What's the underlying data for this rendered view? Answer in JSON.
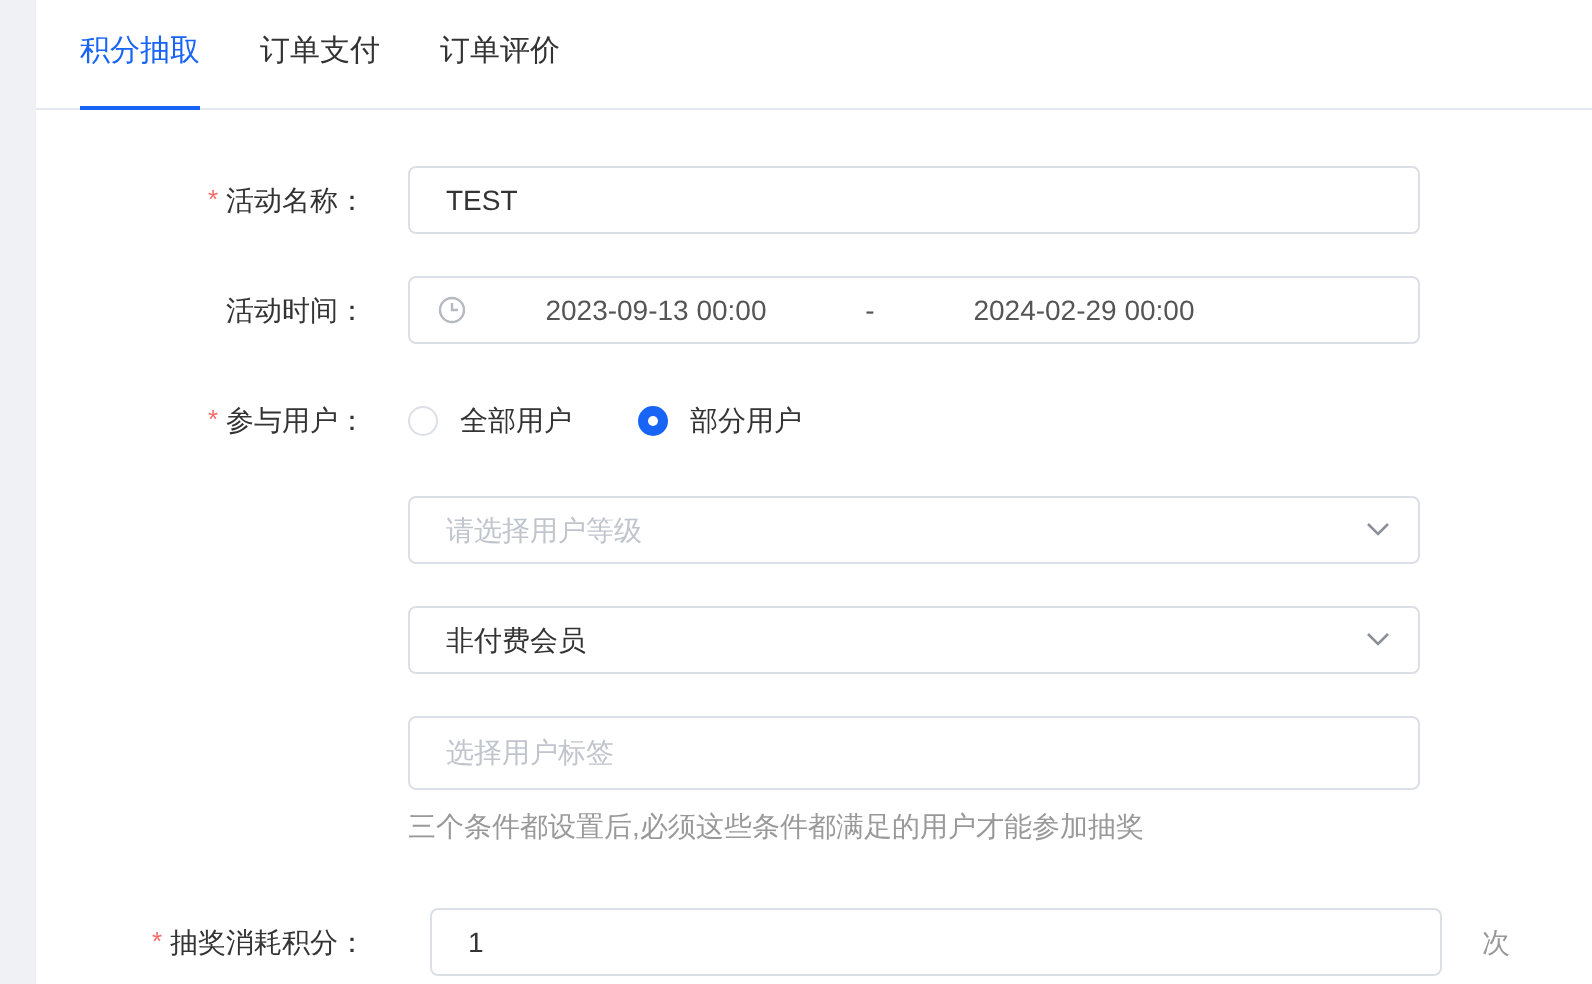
{
  "tabs": [
    {
      "label": "积分抽取",
      "selected": true
    },
    {
      "label": "订单支付",
      "selected": false
    },
    {
      "label": "订单评价",
      "selected": false
    }
  ],
  "form": {
    "rows": [
      {
        "kind": "text",
        "label": "活动名称：",
        "required_mark": "*",
        "value": "TEST"
      },
      {
        "kind": "daterange",
        "label": "活动时间：",
        "start": "2023-09-13 00:00",
        "separator": "-",
        "end": "2024-02-29 00:00"
      },
      {
        "kind": "radio",
        "label": "参与用户：",
        "required_mark": "*",
        "options": [
          {
            "label": "全部用户",
            "selected": false
          },
          {
            "label": "部分用户",
            "selected": true
          }
        ]
      },
      {
        "kind": "select",
        "placeholder": "请选择用户等级"
      },
      {
        "kind": "select",
        "value": "非付费会员"
      },
      {
        "kind": "text",
        "placeholder": "选择用户标签",
        "hint": "三个条件都设置后,必须这些条件都满足的用户才能参加抽奖"
      },
      {
        "kind": "text",
        "label": "抽奖消耗积分：",
        "required_mark": "*",
        "value": "1",
        "suffix": "次"
      }
    ]
  }
}
